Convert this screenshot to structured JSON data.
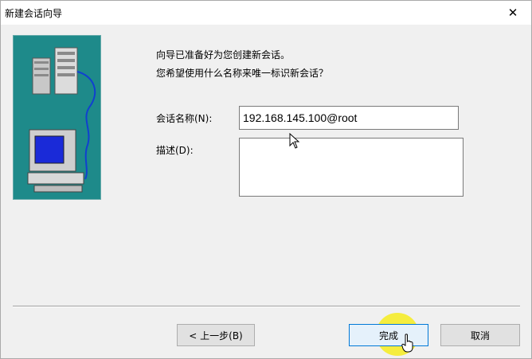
{
  "window": {
    "title": "新建会话向导",
    "close_glyph": "✕"
  },
  "intro": {
    "line1": "向导已准备好为您创建新会话。",
    "line2": "您希望使用什么名称来唯一标识新会话？"
  },
  "form": {
    "name_label": "会话名称(N):",
    "name_value": "192.168.145.100@root",
    "description_label": "描述(D):",
    "description_value": ""
  },
  "buttons": {
    "back": "< 上一步(B)",
    "finish": "完成",
    "cancel": "取消"
  },
  "colors": {
    "illustration_bg": "#1e8a8a",
    "highlight": "#f6ec1e",
    "default_button_border": "#0078d7"
  }
}
